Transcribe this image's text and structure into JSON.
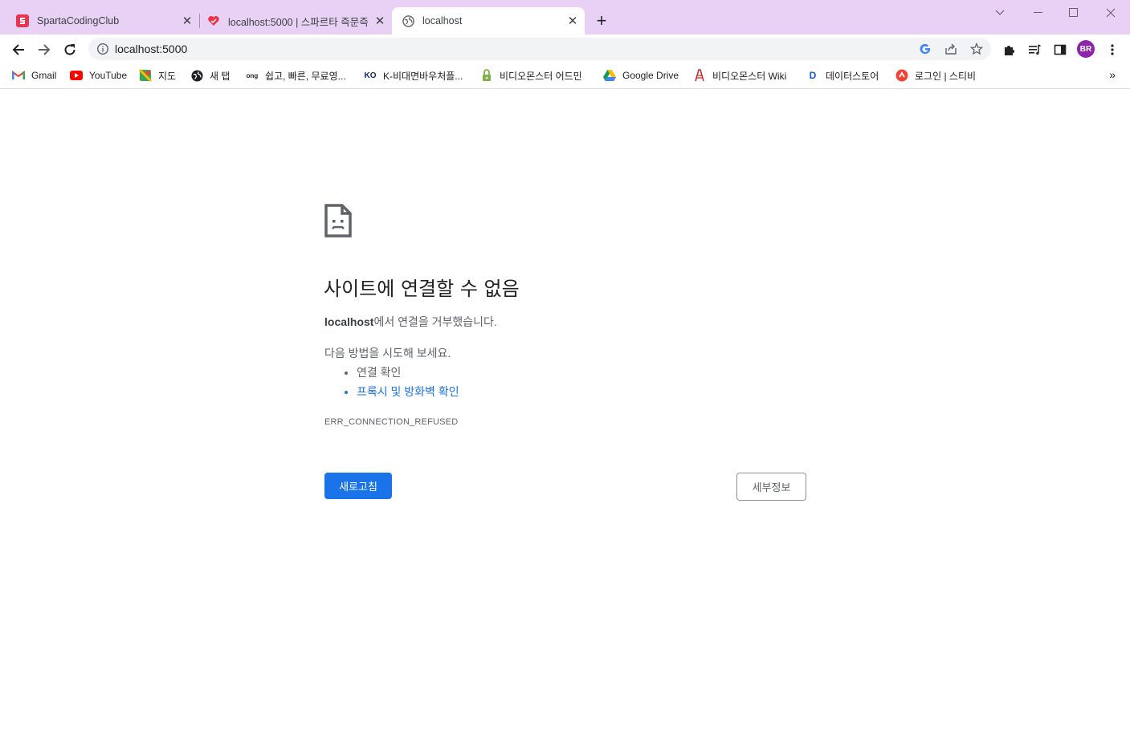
{
  "tabs": [
    {
      "title": "SpartaCodingClub",
      "favicon": "sparta-icon",
      "active": false
    },
    {
      "title": "localhost:5000 | 스파르타 즉문즉",
      "favicon": "heart-icon",
      "active": false
    },
    {
      "title": "localhost",
      "favicon": "globe-icon",
      "active": true
    }
  ],
  "toolbar": {
    "url": "localhost:5000",
    "avatar_initials": "BR"
  },
  "bookmarks": [
    {
      "label": "Gmail",
      "icon": "gmail-icon"
    },
    {
      "label": "YouTube",
      "icon": "youtube-icon"
    },
    {
      "label": "지도",
      "icon": "maps-icon"
    },
    {
      "label": "새 탭",
      "icon": "globe-icon"
    },
    {
      "label": "쉽고, 빠른, 무료영...",
      "icon": "ong-icon"
    },
    {
      "label": "K-비대면바우처플...",
      "icon": "ko-icon"
    },
    {
      "label": "비디오몬스터 어드민",
      "icon": "lock-icon"
    },
    {
      "label": "Google Drive",
      "icon": "drive-icon"
    },
    {
      "label": "비디오몬스터 Wiki",
      "icon": "wiki-icon"
    },
    {
      "label": "데이터스토어",
      "icon": "d-icon"
    },
    {
      "label": "로그인 | 스티비",
      "icon": "stibee-icon"
    }
  ],
  "error": {
    "title": "사이트에 연결할 수 없음",
    "host": "localhost",
    "desc_suffix": "에서 연결을 거부했습니다.",
    "try_label": "다음 방법을 시도해 보세요.",
    "suggestions": [
      "연결 확인",
      "프록시 및 방화벽 확인"
    ],
    "code": "ERR_CONNECTION_REFUSED",
    "reload_label": "새로고침",
    "details_label": "세부정보"
  },
  "colors": {
    "tabstrip": "#e8d1f5",
    "primary_button": "#1a73e8",
    "link": "#1a73e8",
    "avatar": "#8e24aa"
  }
}
